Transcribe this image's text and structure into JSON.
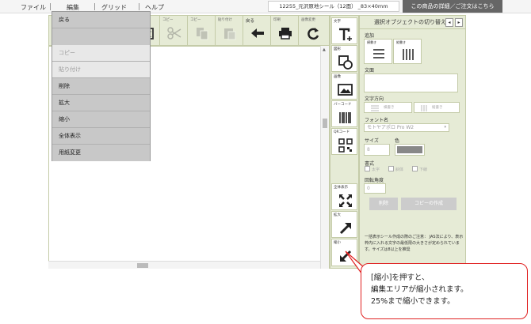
{
  "menubar": {
    "file": "ファイル",
    "edit": "編集",
    "grid": "グリッド",
    "help": "ヘルプ",
    "doc_title": "12255_元沢原地シール（12面） _83×40mm",
    "detail_button": "この商品の詳細／ご注文はこちら"
  },
  "toolbar": {
    "copy_obj": "コピー",
    "paste_obj": "貼り付け",
    "undo": "戻る",
    "print": "印刷",
    "refresh": "画像変更"
  },
  "dropdown": {
    "items": [
      {
        "label": "戻る",
        "enabled": true
      },
      {
        "label": "コピー",
        "enabled": false
      },
      {
        "label": "貼り付け",
        "enabled": false
      },
      {
        "label": "削除",
        "enabled": true
      },
      {
        "label": "拡大",
        "enabled": true
      },
      {
        "label": "縮小",
        "enabled": true
      },
      {
        "label": "全体表示",
        "enabled": true
      },
      {
        "label": "用紙変更",
        "enabled": true
      }
    ]
  },
  "sidebar": {
    "text": "文字",
    "shape": "図形",
    "image": "画像",
    "barcode": "バーコード",
    "qrcode": "QRコード",
    "fit": "全体表示",
    "zoom_in": "拡大",
    "zoom_out": "縮小"
  },
  "panel": {
    "title": "選択オブジェクトの切り替え",
    "prev": "◂",
    "next": "▸",
    "add_label": "追加",
    "horizontal": "横書き",
    "vertical": "縦書き",
    "text_label": "文面",
    "direction_label": "文字方向",
    "dir_horizontal": "横書き",
    "dir_vertical": "縦書き",
    "font_label": "フォント名",
    "font_value": "モトヤアポロ Pro W2",
    "size_label": "サイズ",
    "size_value": "8",
    "color_label": "色",
    "style_label": "書式",
    "bold": "太字",
    "italic": "斜体",
    "underline": "下線",
    "rotation_label": "回転角度",
    "rotation_value": "0",
    "delete_button": "削除",
    "copy_button": "コピーの作成",
    "note": "一括表示シール作成の際のご注意： JAS法により、表示枠内に入れる文字の最低限の大きさが定められています。サイズは8以上を推奨"
  },
  "callout": {
    "line1": "[縮小]を押すと、",
    "line2": "編集エリアが縮小されます。",
    "line3": "25%まで縮小できます。"
  },
  "colors": {
    "accent": "#e6ebd6",
    "callout_border": "#e02020",
    "menu_gray": "#c8c8c8"
  }
}
